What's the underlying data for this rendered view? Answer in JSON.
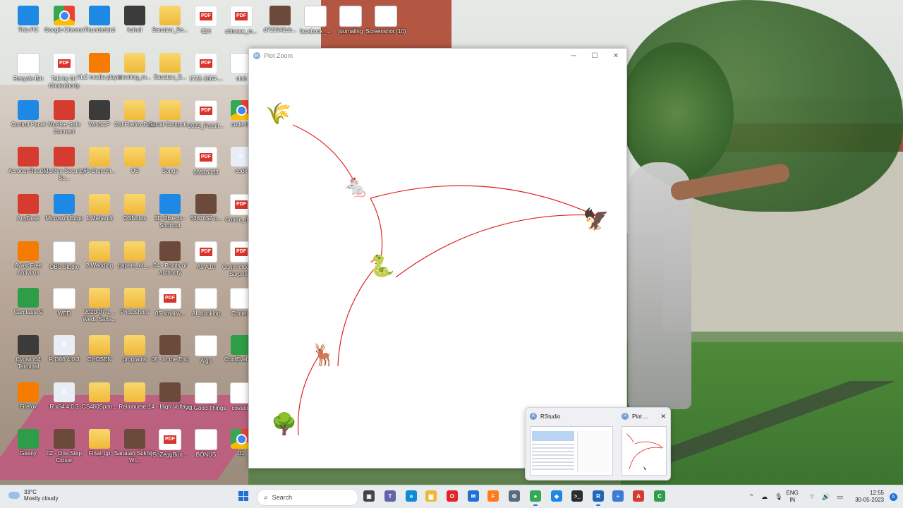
{
  "desktop": {
    "icons": [
      {
        "label": "This PC",
        "kind": "pc"
      },
      {
        "label": "Google Chrome",
        "kind": "chrome"
      },
      {
        "label": "Thunderbird",
        "kind": "blue"
      },
      {
        "label": "kshell",
        "kind": "dark"
      },
      {
        "label": "Sanatan_Se...",
        "kind": "folder"
      },
      {
        "label": "624",
        "kind": "pdf"
      },
      {
        "label": "chinese_m...",
        "kind": "pdf"
      },
      {
        "label": "d723342cb...",
        "kind": "pic"
      },
      {
        "label": "facebook_...",
        "kind": "doc"
      },
      {
        "label": "journaling",
        "kind": "doc"
      },
      {
        "label": "Screenshot (10)",
        "kind": "doc"
      },
      {
        "label": "Recycle Bin",
        "kind": "doc"
      },
      {
        "label": "Talk by Dr. Chakraborty",
        "kind": "pdf"
      },
      {
        "label": "VLC media player",
        "kind": "orange"
      },
      {
        "label": "meeting_m...",
        "kind": "folder"
      },
      {
        "label": "Sanatan_S...",
        "kind": "folder"
      },
      {
        "label": "1721-1864-...",
        "kind": "pdf"
      },
      {
        "label": "club",
        "kind": "doc"
      },
      {
        "label": "Control Panel",
        "kind": "blue"
      },
      {
        "label": "McAfee Safe Connect",
        "kind": "red"
      },
      {
        "label": "WinSCP",
        "kind": "dark"
      },
      {
        "label": "Old Firefox Data",
        "kind": "folder"
      },
      {
        "label": "Social Computi...",
        "kind": "folder"
      },
      {
        "label": "2023_Facult...",
        "kind": "pdf"
      },
      {
        "label": "code.hb",
        "kind": "chrome"
      },
      {
        "label": "Acrobat Reader",
        "kind": "red"
      },
      {
        "label": "McAfee Security Sc...",
        "kind": "red"
      },
      {
        "label": "#5-Crunchi...",
        "kind": "folder"
      },
      {
        "label": "OS",
        "kind": "folder"
      },
      {
        "label": "Songs",
        "kind": "folder"
      },
      {
        "label": "06516463",
        "kind": "pdf"
      },
      {
        "label": "code",
        "kind": "r"
      },
      {
        "label": "AnyDesk",
        "kind": "red"
      },
      {
        "label": "Microsoft Edge",
        "kind": "blue"
      },
      {
        "label": "1.Mehandi",
        "kind": "folder"
      },
      {
        "label": "OSNotes",
        "kind": "folder"
      },
      {
        "label": "3D Objects - Shortcut",
        "kind": "blue"
      },
      {
        "label": "6367652-c...",
        "kind": "pic"
      },
      {
        "label": "Comm_det...",
        "kind": "pdf"
      },
      {
        "label": "Avast Free Antivirus",
        "kind": "orange"
      },
      {
        "label": "OBS Studio",
        "kind": "doc"
      },
      {
        "label": "2.Wedding",
        "kind": "folder"
      },
      {
        "label": "papers_of_...",
        "kind": "folder"
      },
      {
        "label": "04 - Points of Authority",
        "kind": "pic"
      },
      {
        "label": "A9 A10",
        "kind": "pdf"
      },
      {
        "label": "Connected The Surprisi...",
        "kind": "pdf"
      },
      {
        "label": "Camtasia 9",
        "kind": "green"
      },
      {
        "label": "WED",
        "kind": "doc"
      },
      {
        "label": "2020-07-1... Weds Sana...",
        "kind": "folder"
      },
      {
        "label": "Photoshoot",
        "kind": "folder"
      },
      {
        "label": "05-smallw...",
        "kind": "pdf"
      },
      {
        "label": "AI_booking",
        "kind": "doc"
      },
      {
        "label": "Content",
        "kind": "doc"
      },
      {
        "label": "Cygwin64 Terminal",
        "kind": "dark"
      },
      {
        "label": "R i386 4.0.3",
        "kind": "r"
      },
      {
        "label": "CHOSEN",
        "kind": "folder"
      },
      {
        "label": "programs",
        "kind": "folder"
      },
      {
        "label": "08 - In the End",
        "kind": "pic"
      },
      {
        "label": "Algo",
        "kind": "doc"
      },
      {
        "label": "ContEval20...",
        "kind": "green"
      },
      {
        "label": "Firefox",
        "kind": "orange"
      },
      {
        "label": "R x64 4.0.3",
        "kind": "r"
      },
      {
        "label": "CS480Sprin...",
        "kind": "folder"
      },
      {
        "label": "Reimburse...",
        "kind": "folder"
      },
      {
        "label": "14 - High Voltage",
        "kind": "pic"
      },
      {
        "label": "All Good Things",
        "kind": "doc"
      },
      {
        "label": "covaxin",
        "kind": "doc"
      },
      {
        "label": "Geany",
        "kind": "green"
      },
      {
        "label": "02 - One Step Closer",
        "kind": "pic"
      },
      {
        "label": "Final_gp",
        "kind": "folder"
      },
      {
        "label": "Sanatan Sukhija Wi...",
        "kind": "pic"
      },
      {
        "label": "SoZeggBun...",
        "kind": "pdf"
      },
      {
        "label": "BONUS",
        "kind": "doc"
      },
      {
        "label": "d1",
        "kind": "chrome"
      }
    ]
  },
  "plot_window": {
    "title": "Plot Zoom",
    "icon": "R",
    "controls": {
      "minimize": "─",
      "maximize": "☐",
      "close": "✕"
    }
  },
  "food_web": {
    "nodes": [
      {
        "id": "grass",
        "name": "grass",
        "emoji": "🌾"
      },
      {
        "id": "mouse",
        "name": "mouse",
        "emoji": "🐁"
      },
      {
        "id": "eagle",
        "name": "eagle",
        "emoji": "🦅"
      },
      {
        "id": "snake",
        "name": "snake",
        "emoji": "🐍"
      },
      {
        "id": "deer",
        "name": "deer",
        "emoji": "🦌"
      },
      {
        "id": "tree",
        "name": "tree",
        "emoji": "🌳"
      }
    ],
    "edges": [
      {
        "from": "grass",
        "to": "mouse"
      },
      {
        "from": "mouse",
        "to": "eagle"
      },
      {
        "from": "mouse",
        "to": "snake"
      },
      {
        "from": "snake",
        "to": "eagle"
      },
      {
        "from": "deer",
        "to": "snake"
      },
      {
        "from": "tree",
        "to": "deer"
      }
    ],
    "edge_color": "#e0201c"
  },
  "preview": {
    "items": [
      {
        "label": "RStudio",
        "icon": "R"
      },
      {
        "label": "Plot ...",
        "icon": "R",
        "close": "✕"
      }
    ]
  },
  "taskbar": {
    "weather_temp": "33°C",
    "weather_text": "Mostly cloudy",
    "search_placeholder": "Search",
    "apps": [
      {
        "name": "task-view-icon",
        "glyph": "▣",
        "color": "#444"
      },
      {
        "name": "teams-icon",
        "glyph": "T",
        "color": "#6264a7"
      },
      {
        "name": "edge-icon",
        "glyph": "e",
        "color": "#0f8bd6"
      },
      {
        "name": "file-explorer-icon",
        "glyph": "▆",
        "color": "#f2b634"
      },
      {
        "name": "opera-icon",
        "glyph": "O",
        "color": "#e2242b"
      },
      {
        "name": "mail-icon",
        "glyph": "✉",
        "color": "#1f6fd6"
      },
      {
        "name": "firefox-icon",
        "glyph": "F",
        "color": "#ff7a1a"
      },
      {
        "name": "settings-icon",
        "glyph": "⚙",
        "color": "#5a6b7a"
      },
      {
        "name": "chrome-icon",
        "glyph": "●",
        "color": "#34a853"
      },
      {
        "name": "vscode-icon",
        "glyph": "◆",
        "color": "#1e88e5"
      },
      {
        "name": "terminal-icon",
        "glyph": ">_",
        "color": "#2b2b2b"
      },
      {
        "name": "r-icon",
        "glyph": "R",
        "color": "#2266b8"
      },
      {
        "name": "notepad-icon",
        "glyph": "≡",
        "color": "#3a7bd5"
      },
      {
        "name": "acrobat-icon",
        "glyph": "A",
        "color": "#d63b2f"
      },
      {
        "name": "camtasia-icon",
        "glyph": "C",
        "color": "#2e9d48"
      }
    ],
    "lang_top": "ENG",
    "lang_bottom": "IN",
    "time": "12:55",
    "date": "30-05-2023",
    "notification_count": "6"
  }
}
